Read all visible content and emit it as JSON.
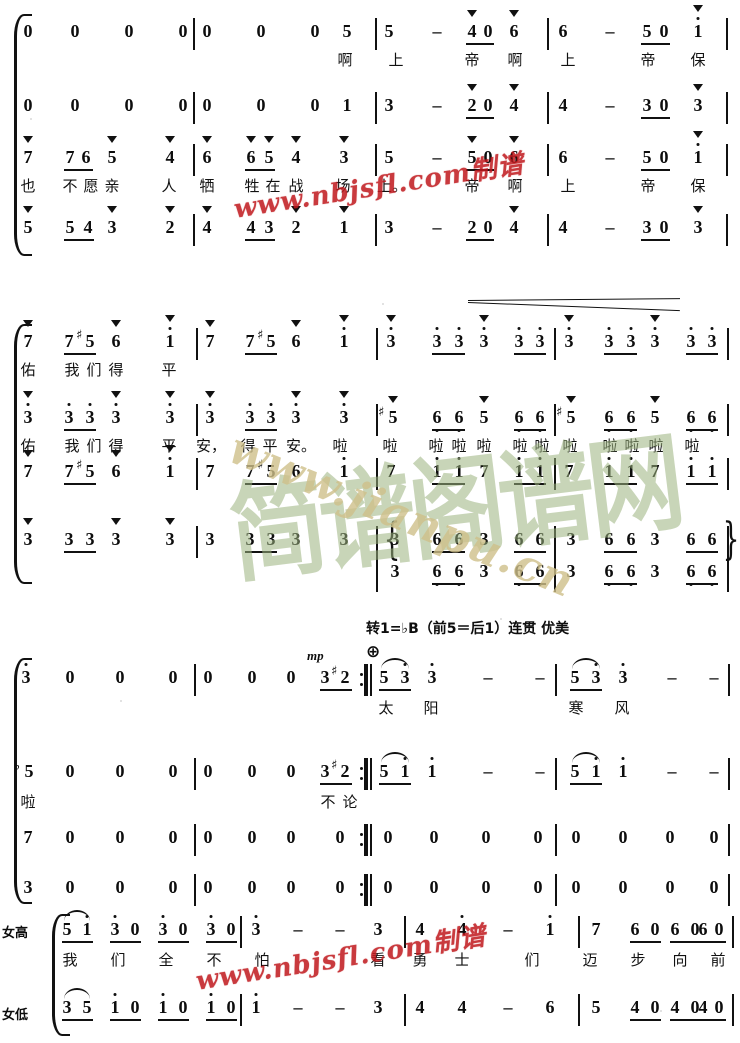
{
  "document": {
    "type": "jianpu-choral-score",
    "language": "zh",
    "tempo_marking": "转1=♭B（前5＝后1）连贯  优美",
    "dynamic_mp": "mp",
    "coda_symbol": "⊕"
  },
  "part_labels": {
    "soprano": "女高",
    "alto": "女低"
  },
  "systems": [
    {
      "id": "system-1",
      "staves": [
        {
          "id": "s1-v1",
          "notes": [
            "0",
            "0",
            "0",
            "0",
            "0",
            "0",
            "0",
            "5",
            "5",
            "-",
            "4",
            "0",
            "6",
            "6",
            "-",
            "5",
            "0",
            "1"
          ],
          "lyrics": [
            "啊",
            "上",
            "帝",
            "啊",
            "上",
            "帝",
            "保"
          ]
        },
        {
          "id": "s1-v2",
          "notes": [
            "0",
            "0",
            "0",
            "0",
            "0",
            "0",
            "0",
            "1",
            "3",
            "-",
            "2",
            "0",
            "4",
            "4",
            "-",
            "3",
            "0",
            "3"
          ],
          "lyrics": []
        },
        {
          "id": "s1-v3",
          "notes": [
            "7",
            "7",
            "6",
            "5",
            "4",
            "6",
            "6",
            "5",
            "4",
            "3",
            "5",
            "-",
            "5",
            "0",
            "6",
            "6",
            "-",
            "5",
            "0",
            "1"
          ],
          "lyrics": [
            "也",
            "不",
            "愿",
            "亲",
            "人",
            "牺",
            "牲",
            "在",
            "战",
            "场",
            "上。",
            "帝",
            "啊",
            "上",
            "帝",
            "保"
          ]
        },
        {
          "id": "s1-v4",
          "notes": [
            "5",
            "5",
            "4",
            "3",
            "2",
            "4",
            "4",
            "3",
            "2",
            "1",
            "3",
            "-",
            "2",
            "0",
            "4",
            "4",
            "-",
            "3",
            "0",
            "3"
          ],
          "lyrics": []
        }
      ]
    },
    {
      "id": "system-2",
      "staves": [
        {
          "id": "s2-v1",
          "notes": [
            "7",
            "7",
            "5",
            "6",
            "1",
            "7",
            "7",
            "5",
            "6",
            "1",
            "3",
            "3",
            "3",
            "3",
            "3",
            "3",
            "3",
            "3",
            "3",
            "3",
            "3",
            "3"
          ],
          "lyrics": [
            "佑",
            "我",
            "们",
            "得",
            "平"
          ]
        },
        {
          "id": "s2-v2",
          "notes": [
            "3",
            "3",
            "3",
            "3",
            "3",
            "3",
            "3",
            "3",
            "3",
            "3",
            "5",
            "6",
            "6",
            "5",
            "6",
            "6",
            "5",
            "6",
            "6",
            "5",
            "6",
            "6"
          ],
          "lyrics": [
            "佑",
            "我",
            "们",
            "得",
            "平",
            "安，",
            "得",
            "平",
            "安。",
            "啦",
            "啦",
            "啦",
            "啦",
            "啦",
            "啦",
            "啦",
            "啦",
            "啦",
            "啦",
            "啦",
            "啦"
          ]
        },
        {
          "id": "s2-v3",
          "notes": [
            "7",
            "7",
            "5",
            "6",
            "1",
            "7",
            "7",
            "5",
            "6",
            "1",
            "7",
            "1",
            "1",
            "7",
            "1",
            "1",
            "7",
            "1",
            "1",
            "7",
            "1",
            "1"
          ],
          "lyrics": []
        },
        {
          "id": "s2-v4a",
          "notes": [
            "3",
            "3",
            "3",
            "3",
            "3",
            "3",
            "3",
            "3",
            "3",
            "3",
            "3",
            "6",
            "6",
            "3",
            "6",
            "6",
            "3",
            "6",
            "6",
            "3",
            "6",
            "6"
          ],
          "lyrics": []
        },
        {
          "id": "s2-v4b",
          "notes": [
            "3",
            "6",
            "6",
            "3",
            "6",
            "6",
            "3",
            "6",
            "6",
            "3",
            "6",
            "6"
          ],
          "lyrics": []
        }
      ]
    },
    {
      "id": "system-3",
      "staves": [
        {
          "id": "s3-v1",
          "notes": [
            "3",
            "0",
            "0",
            "0",
            "0",
            "0",
            "0",
            "3",
            "2",
            "5",
            "3",
            "3",
            "-",
            "-",
            "5",
            "3",
            "3",
            "-",
            "-"
          ],
          "lyrics": [
            "太",
            "阳",
            "寒",
            "风"
          ]
        },
        {
          "id": "s3-v2",
          "notes": [
            "5",
            "0",
            "0",
            "0",
            "0",
            "0",
            "0",
            "3",
            "2",
            "5",
            "1",
            "1",
            "-",
            "-",
            "5",
            "1",
            "1",
            "-",
            "-"
          ],
          "lyrics": [
            "啦",
            "不",
            "论"
          ]
        },
        {
          "id": "s3-v3",
          "notes": [
            "7",
            "0",
            "0",
            "0",
            "0",
            "0",
            "0",
            "0",
            "0",
            "0",
            "0",
            "0",
            "0",
            "0",
            "0",
            "0"
          ],
          "lyrics": []
        },
        {
          "id": "s3-v4",
          "notes": [
            "3",
            "0",
            "0",
            "0",
            "0",
            "0",
            "0",
            "0",
            "0",
            "0",
            "0",
            "0",
            "0",
            "0",
            "0",
            "0"
          ],
          "lyrics": []
        }
      ]
    },
    {
      "id": "system-4",
      "staves": [
        {
          "id": "s4-soprano",
          "notes": [
            "5",
            "1",
            "3",
            "0",
            "3",
            "0",
            "3",
            "0",
            "3",
            "-",
            "-",
            "3",
            "4",
            "4",
            "-",
            "1",
            "7",
            "6",
            "0",
            "6",
            "0",
            "6",
            "0"
          ],
          "lyrics": [
            "我",
            "们",
            "全",
            "不",
            "怕",
            "看",
            "勇",
            "士",
            "们",
            "迈",
            "步",
            "向",
            "前"
          ]
        },
        {
          "id": "s4-alto",
          "notes": [
            "3",
            "5",
            "1",
            "0",
            "1",
            "0",
            "1",
            "0",
            "1",
            "-",
            "-",
            "3",
            "4",
            "4",
            "-",
            "6",
            "5",
            "4",
            "0",
            "4",
            "0",
            "4",
            "0"
          ],
          "lyrics": []
        }
      ]
    }
  ],
  "watermarks": [
    {
      "id": "wm-red-1",
      "text": "www.nbjsfl.com制谱",
      "color": "#c0181d"
    },
    {
      "id": "wm-red-2",
      "text": "www.nbjsfl.com制谱",
      "color": "#c0181d"
    },
    {
      "id": "wm-green-logo",
      "text": "简谱阁谱网",
      "color": "#9cb37f"
    },
    {
      "id": "wm-olive-url",
      "text": "www.jianpu.cn",
      "color": "#cfc08a"
    }
  ]
}
